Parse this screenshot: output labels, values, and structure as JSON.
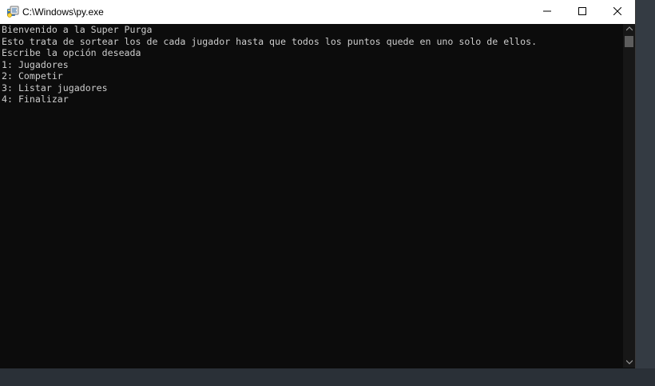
{
  "window": {
    "title": "C:\\Windows\\py.exe",
    "icon": "python-launcher-icon"
  },
  "controls": {
    "minimize": "minimize-icon",
    "maximize": "maximize-icon",
    "close": "close-icon"
  },
  "console": {
    "lines": [
      "Bienvenido a la Super Purga",
      "Esto trata de sortear los de cada jugador hasta que todos los puntos quede en uno solo de ellos.",
      "Escribe la opción deseada",
      "1: Jugadores",
      "2: Competir",
      "3: Listar jugadores",
      "4: Finalizar"
    ]
  },
  "colors": {
    "console_background": "#0c0c0c",
    "console_text": "#cccccc",
    "titlebar": "#ffffff"
  }
}
